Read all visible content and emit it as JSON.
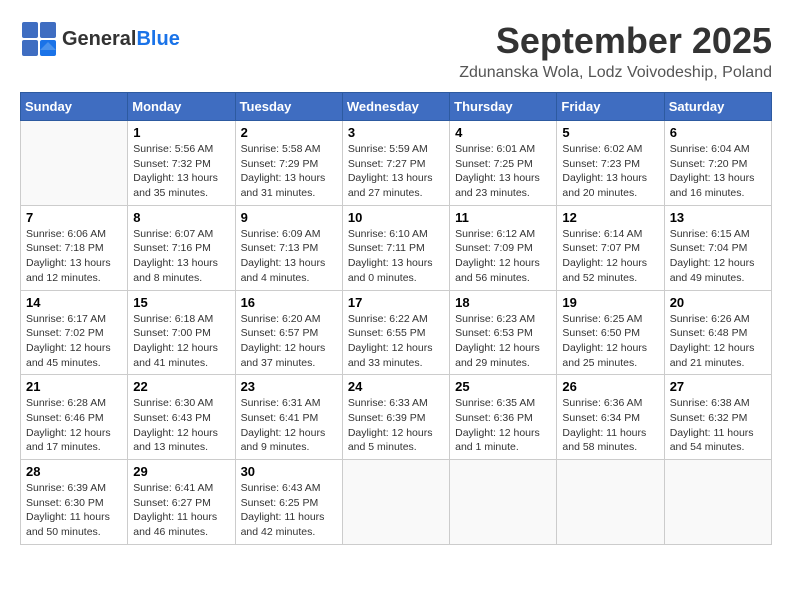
{
  "header": {
    "logo_general": "General",
    "logo_blue": "Blue",
    "month": "September 2025",
    "location": "Zdunanska Wola, Lodz Voivodeship, Poland"
  },
  "columns": [
    "Sunday",
    "Monday",
    "Tuesday",
    "Wednesday",
    "Thursday",
    "Friday",
    "Saturday"
  ],
  "weeks": [
    [
      {
        "day": "",
        "info": ""
      },
      {
        "day": "1",
        "info": "Sunrise: 5:56 AM\nSunset: 7:32 PM\nDaylight: 13 hours\nand 35 minutes."
      },
      {
        "day": "2",
        "info": "Sunrise: 5:58 AM\nSunset: 7:29 PM\nDaylight: 13 hours\nand 31 minutes."
      },
      {
        "day": "3",
        "info": "Sunrise: 5:59 AM\nSunset: 7:27 PM\nDaylight: 13 hours\nand 27 minutes."
      },
      {
        "day": "4",
        "info": "Sunrise: 6:01 AM\nSunset: 7:25 PM\nDaylight: 13 hours\nand 23 minutes."
      },
      {
        "day": "5",
        "info": "Sunrise: 6:02 AM\nSunset: 7:23 PM\nDaylight: 13 hours\nand 20 minutes."
      },
      {
        "day": "6",
        "info": "Sunrise: 6:04 AM\nSunset: 7:20 PM\nDaylight: 13 hours\nand 16 minutes."
      }
    ],
    [
      {
        "day": "7",
        "info": "Sunrise: 6:06 AM\nSunset: 7:18 PM\nDaylight: 13 hours\nand 12 minutes."
      },
      {
        "day": "8",
        "info": "Sunrise: 6:07 AM\nSunset: 7:16 PM\nDaylight: 13 hours\nand 8 minutes."
      },
      {
        "day": "9",
        "info": "Sunrise: 6:09 AM\nSunset: 7:13 PM\nDaylight: 13 hours\nand 4 minutes."
      },
      {
        "day": "10",
        "info": "Sunrise: 6:10 AM\nSunset: 7:11 PM\nDaylight: 13 hours\nand 0 minutes."
      },
      {
        "day": "11",
        "info": "Sunrise: 6:12 AM\nSunset: 7:09 PM\nDaylight: 12 hours\nand 56 minutes."
      },
      {
        "day": "12",
        "info": "Sunrise: 6:14 AM\nSunset: 7:07 PM\nDaylight: 12 hours\nand 52 minutes."
      },
      {
        "day": "13",
        "info": "Sunrise: 6:15 AM\nSunset: 7:04 PM\nDaylight: 12 hours\nand 49 minutes."
      }
    ],
    [
      {
        "day": "14",
        "info": "Sunrise: 6:17 AM\nSunset: 7:02 PM\nDaylight: 12 hours\nand 45 minutes."
      },
      {
        "day": "15",
        "info": "Sunrise: 6:18 AM\nSunset: 7:00 PM\nDaylight: 12 hours\nand 41 minutes."
      },
      {
        "day": "16",
        "info": "Sunrise: 6:20 AM\nSunset: 6:57 PM\nDaylight: 12 hours\nand 37 minutes."
      },
      {
        "day": "17",
        "info": "Sunrise: 6:22 AM\nSunset: 6:55 PM\nDaylight: 12 hours\nand 33 minutes."
      },
      {
        "day": "18",
        "info": "Sunrise: 6:23 AM\nSunset: 6:53 PM\nDaylight: 12 hours\nand 29 minutes."
      },
      {
        "day": "19",
        "info": "Sunrise: 6:25 AM\nSunset: 6:50 PM\nDaylight: 12 hours\nand 25 minutes."
      },
      {
        "day": "20",
        "info": "Sunrise: 6:26 AM\nSunset: 6:48 PM\nDaylight: 12 hours\nand 21 minutes."
      }
    ],
    [
      {
        "day": "21",
        "info": "Sunrise: 6:28 AM\nSunset: 6:46 PM\nDaylight: 12 hours\nand 17 minutes."
      },
      {
        "day": "22",
        "info": "Sunrise: 6:30 AM\nSunset: 6:43 PM\nDaylight: 12 hours\nand 13 minutes."
      },
      {
        "day": "23",
        "info": "Sunrise: 6:31 AM\nSunset: 6:41 PM\nDaylight: 12 hours\nand 9 minutes."
      },
      {
        "day": "24",
        "info": "Sunrise: 6:33 AM\nSunset: 6:39 PM\nDaylight: 12 hours\nand 5 minutes."
      },
      {
        "day": "25",
        "info": "Sunrise: 6:35 AM\nSunset: 6:36 PM\nDaylight: 12 hours\nand 1 minute."
      },
      {
        "day": "26",
        "info": "Sunrise: 6:36 AM\nSunset: 6:34 PM\nDaylight: 11 hours\nand 58 minutes."
      },
      {
        "day": "27",
        "info": "Sunrise: 6:38 AM\nSunset: 6:32 PM\nDaylight: 11 hours\nand 54 minutes."
      }
    ],
    [
      {
        "day": "28",
        "info": "Sunrise: 6:39 AM\nSunset: 6:30 PM\nDaylight: 11 hours\nand 50 minutes."
      },
      {
        "day": "29",
        "info": "Sunrise: 6:41 AM\nSunset: 6:27 PM\nDaylight: 11 hours\nand 46 minutes."
      },
      {
        "day": "30",
        "info": "Sunrise: 6:43 AM\nSunset: 6:25 PM\nDaylight: 11 hours\nand 42 minutes."
      },
      {
        "day": "",
        "info": ""
      },
      {
        "day": "",
        "info": ""
      },
      {
        "day": "",
        "info": ""
      },
      {
        "day": "",
        "info": ""
      }
    ]
  ]
}
